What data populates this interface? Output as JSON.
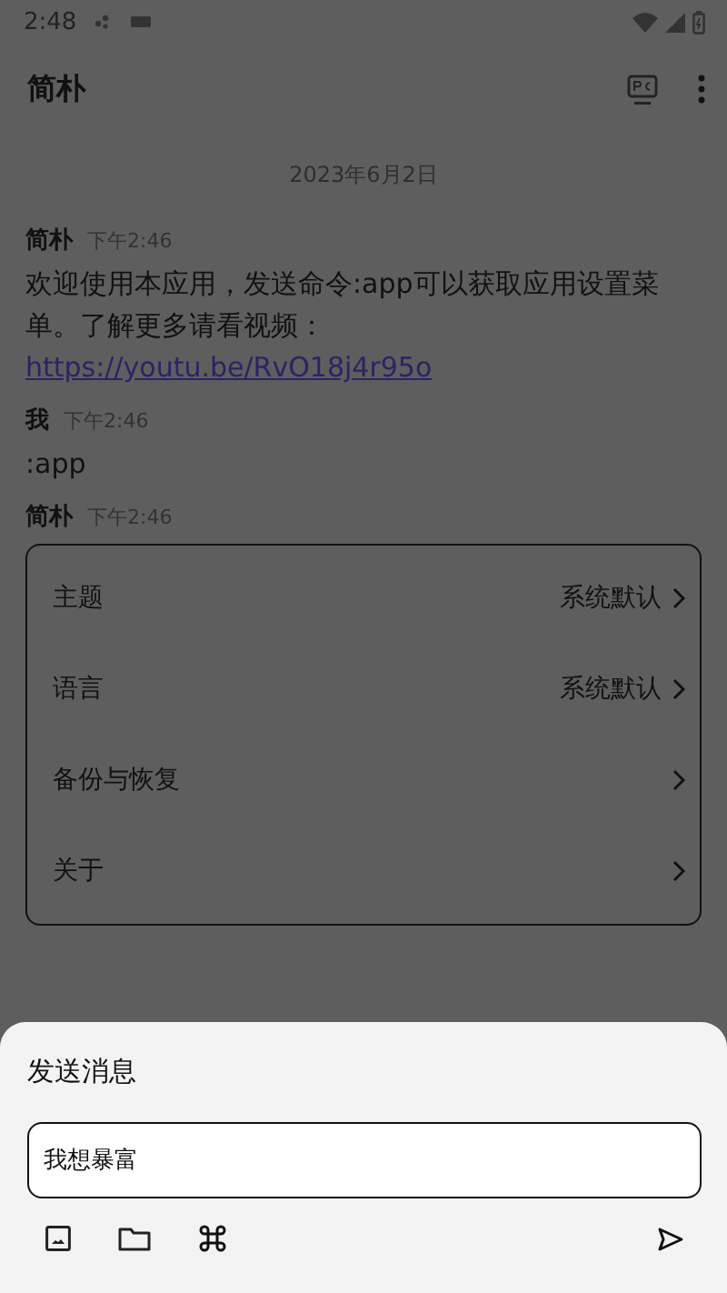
{
  "status_bar": {
    "time": "2:48"
  },
  "header": {
    "title": "简朴"
  },
  "date_divider": "2023年6月2日",
  "messages": [
    {
      "sender": "简朴",
      "time": "下午2:46",
      "kind": "text",
      "text": "欢迎使用本应用，发送命令:app可以获取应用设置菜单。了解更多请看视频：",
      "link": "https://youtu.be/RvO18j4r95o"
    },
    {
      "sender": "我",
      "time": "下午2:46",
      "kind": "text",
      "text": ":app"
    },
    {
      "sender": "简朴",
      "time": "下午2:46",
      "kind": "menu",
      "items": [
        {
          "label": "主题",
          "value": "系统默认"
        },
        {
          "label": "语言",
          "value": "系统默认"
        },
        {
          "label": "备份与恢复"
        },
        {
          "label": "关于"
        }
      ]
    }
  ],
  "composer": {
    "title": "发送消息",
    "value": "我想暴富"
  }
}
